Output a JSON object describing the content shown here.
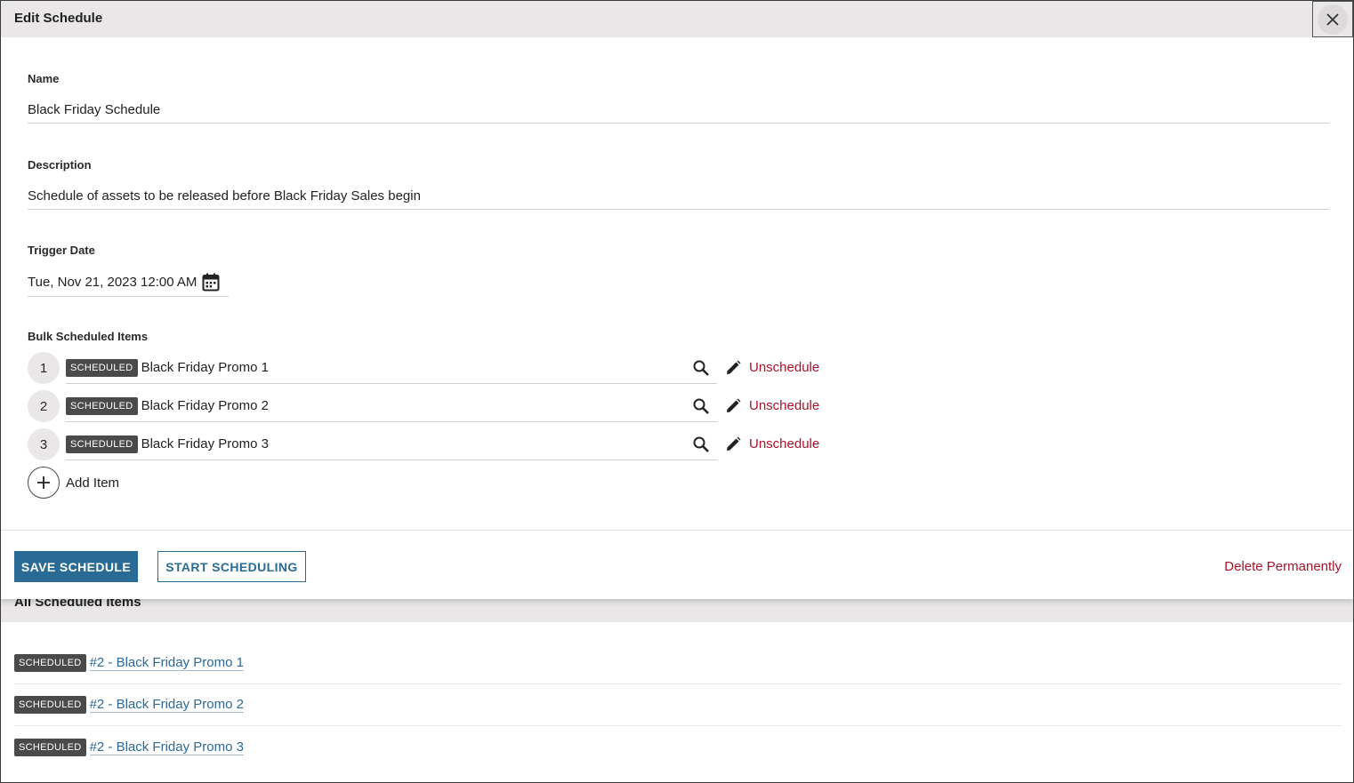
{
  "modal": {
    "title": "Edit Schedule",
    "close_icon": "close-icon",
    "name": {
      "label": "Name",
      "value": "Black Friday Schedule"
    },
    "description": {
      "label": "Description",
      "value": "Schedule of assets to be released before Black Friday Sales begin"
    },
    "trigger_date": {
      "label": "Trigger Date",
      "value": "Tue, Nov 21, 2023 12:00 AM",
      "icon": "calendar-icon"
    },
    "bulk": {
      "label": "Bulk Scheduled Items",
      "items": [
        {
          "number": "1",
          "badge": "SCHEDULED",
          "name": "Black Friday Promo 1",
          "action": "Unschedule"
        },
        {
          "number": "2",
          "badge": "SCHEDULED",
          "name": "Black Friday Promo 2",
          "action": "Unschedule"
        },
        {
          "number": "3",
          "badge": "SCHEDULED",
          "name": "Black Friday Promo 3",
          "action": "Unschedule"
        }
      ],
      "add_label": "Add Item"
    },
    "footer": {
      "save_label": "SAVE SCHEDULE",
      "start_label": "START SCHEDULING",
      "delete_label": "Delete Permanently"
    }
  },
  "all_items": {
    "title": "All Scheduled Items",
    "items": [
      {
        "badge": "SCHEDULED",
        "link": "#2 - Black Friday Promo 1"
      },
      {
        "badge": "SCHEDULED",
        "link": "#2 - Black Friday Promo 2"
      },
      {
        "badge": "SCHEDULED",
        "link": "#2 - Black Friday Promo 3"
      }
    ]
  },
  "colors": {
    "accent": "#2a6b96",
    "danger": "#a8122a",
    "badge": "#4a4a4a",
    "header_bg": "#e9e7e8"
  }
}
